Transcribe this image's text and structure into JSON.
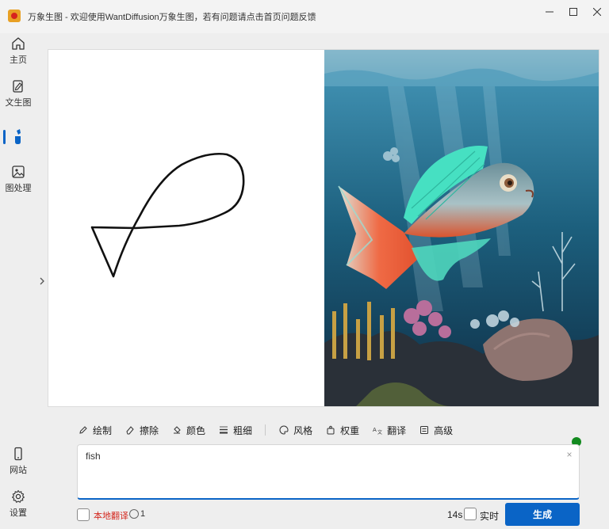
{
  "window": {
    "title": "万象生图 - 欢迎使用WantDiffusion万象生图，若有问题请点击首页问题反馈",
    "controls": [
      "minimize-icon",
      "maximize-icon",
      "close-icon"
    ]
  },
  "sidebar": {
    "items": [
      {
        "label": "主页",
        "icon": "home-icon",
        "active": false
      },
      {
        "label": "文生图",
        "icon": "text-to-image-icon",
        "active": false
      },
      {
        "label": "",
        "icon": "sketch-to-image-icon",
        "active": true
      },
      {
        "label": "图处理",
        "icon": "image-process-icon",
        "active": false
      }
    ],
    "bottom_items": [
      {
        "label": "网站",
        "icon": "phone-icon"
      },
      {
        "label": "设置",
        "icon": "gear-icon"
      }
    ]
  },
  "toolbar": {
    "tools": [
      {
        "label": "绘制",
        "icon": "pencil-icon"
      },
      {
        "label": "擦除",
        "icon": "eraser-icon"
      },
      {
        "label": "颜色",
        "icon": "paint-bucket-icon"
      },
      {
        "label": "粗细",
        "icon": "line-weight-icon"
      },
      {
        "label": "风格",
        "icon": "palette-icon"
      },
      {
        "label": "权重",
        "icon": "weight-icon"
      },
      {
        "label": "翻译",
        "icon": "translate-icon"
      },
      {
        "label": "高级",
        "icon": "advanced-icon"
      }
    ]
  },
  "prompt": {
    "value": "fish",
    "clear": "×"
  },
  "footer": {
    "local_translate": "本地翻译",
    "count": "1",
    "time": "14s",
    "realtime": "实时",
    "generate": "生成"
  },
  "colors": {
    "accent": "#0a64c6",
    "status_dot": "#138a1f",
    "warning_text": "#d4281f"
  }
}
